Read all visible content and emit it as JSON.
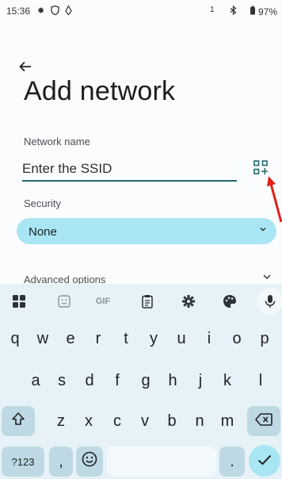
{
  "status_bar": {
    "time": "15:36",
    "left_icons": [
      "settings-icon",
      "shield-icon",
      "location-icon"
    ],
    "sim_indicator": "1",
    "battery": "97%"
  },
  "screen": {
    "title": "Add network",
    "network_name_label": "Network name",
    "network_name_placeholder": "Enter the SSID",
    "security_label": "Security",
    "security_value": "None",
    "advanced_options_label": "Advanced options"
  },
  "keyboard": {
    "toolbar": {
      "gif_label": "GIF"
    },
    "rows": [
      [
        "q",
        "w",
        "e",
        "r",
        "t",
        "y",
        "u",
        "i",
        "o",
        "p"
      ],
      [
        "a",
        "s",
        "d",
        "f",
        "g",
        "h",
        "j",
        "k",
        "l"
      ],
      [
        "z",
        "x",
        "c",
        "v",
        "b",
        "n",
        "m"
      ]
    ],
    "symbols_label": "?123",
    "comma_label": ",",
    "period_label": "."
  },
  "accent_colors": {
    "underline": "#21696e",
    "dropdown_fill": "#a9e6f4",
    "annotation_arrow": "#e0211b"
  }
}
